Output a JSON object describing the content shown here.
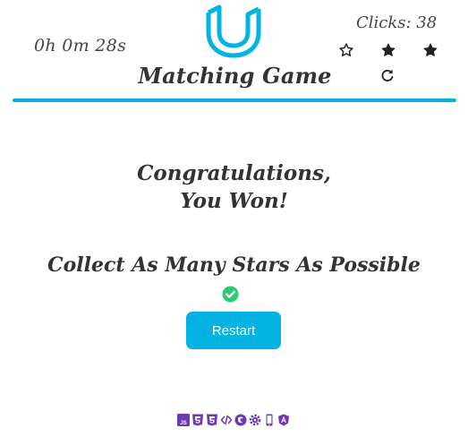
{
  "header": {
    "timer": "0h 0m 28s",
    "title": "Matching Game",
    "clicks_label": "Clicks: 38",
    "rating": {
      "filled": 2,
      "total": 3
    }
  },
  "win_panel": {
    "congrats_line1": "Congratulations,",
    "congrats_line2": "You Won!",
    "subtitle": "Collect As Many Stars As Possible",
    "restart_label": "Restart"
  },
  "footer": {
    "tech_icons": [
      "js-icon",
      "html5-icon",
      "css3-icon",
      "code-icon",
      "firefox-icon",
      "gear-icon",
      "mobile-icon",
      "angular-icon"
    ]
  },
  "colors": {
    "accent": "#02b3e4",
    "success": "#2ecc71",
    "footer_icon": "#6c3bb3",
    "text": "#333333"
  }
}
